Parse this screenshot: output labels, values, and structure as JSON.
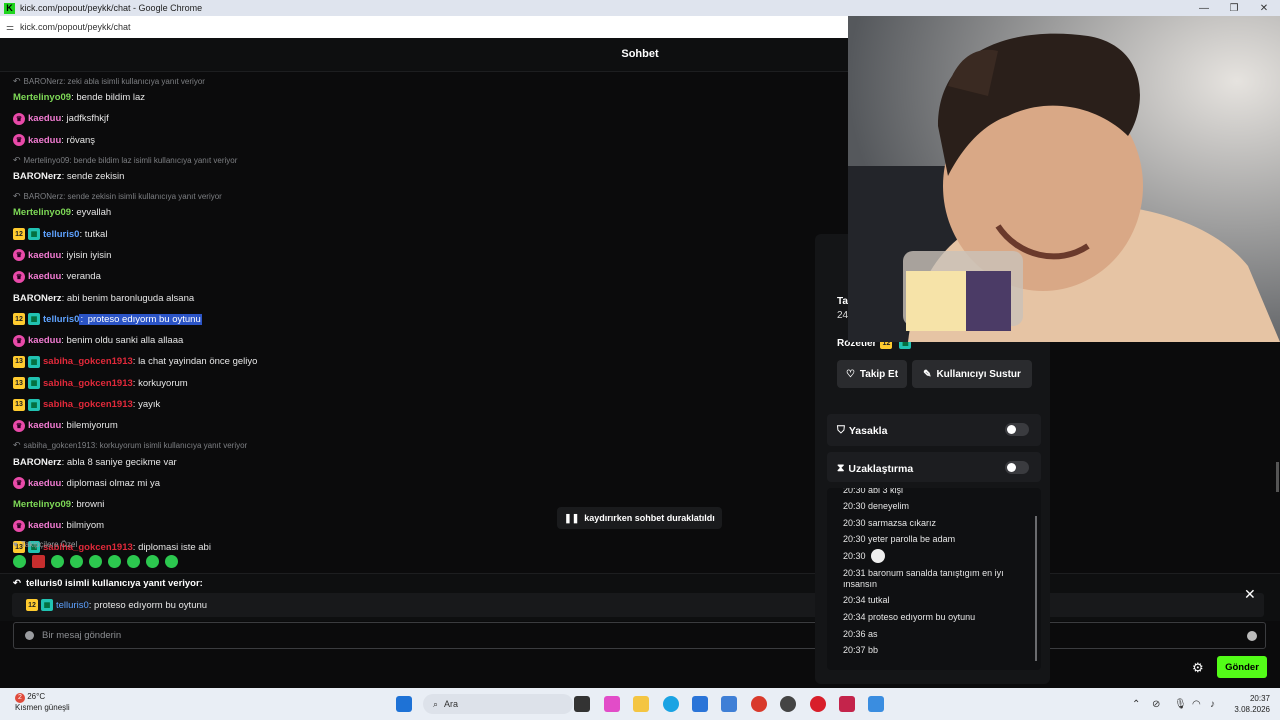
{
  "window": {
    "title": "kick.com/popout/peykk/chat - Google Chrome",
    "url": "kick.com/popout/peykk/chat",
    "app_icon": "K"
  },
  "chat": {
    "header": "Sohbet",
    "entries": [
      {
        "reply": "BARONerz: zeki abla isimli kullanıcıya yanıt veriyor",
        "user": "Mertelinyo09",
        "color": "g",
        "badges": [],
        "msg": "bende bildim laz"
      },
      {
        "user": "kaeduu",
        "color": "p",
        "badges": [
          "pink"
        ],
        "msg": "jadfksfhkjf"
      },
      {
        "user": "kaeduu",
        "color": "p",
        "badges": [
          "pink"
        ],
        "msg": "rövanş"
      },
      {
        "reply": "Mertelinyo09: bende bildim laz isimli kullanıcıya yanıt veriyor",
        "user": "BARONerz",
        "color": "w",
        "badges": [],
        "msg": "sende zekisin"
      },
      {
        "reply": "BARONerz: sende zekisin isimli kullanıcıya yanıt veriyor",
        "user": "Mertelinyo09",
        "color": "g",
        "badges": [],
        "msg": "eyvallah"
      },
      {
        "user": "telluris0",
        "color": "b",
        "badges": [
          "gold",
          "teal"
        ],
        "badge_text": "12",
        "msg": "tutkal"
      },
      {
        "user": "kaeduu",
        "color": "p",
        "badges": [
          "pink"
        ],
        "msg": "iyisin iyisin"
      },
      {
        "user": "kaeduu",
        "color": "p",
        "badges": [
          "pink"
        ],
        "msg": "veranda"
      },
      {
        "user": "BARONerz",
        "color": "w",
        "badges": [],
        "msg": "abi benim baronluguda alsana"
      },
      {
        "user": "telluris0",
        "color": "b",
        "badges": [
          "gold",
          "teal"
        ],
        "badge_text": "12",
        "msg": "proteso edıyorm bu oytunu",
        "highlight": true
      },
      {
        "user": "kaeduu",
        "color": "p",
        "badges": [
          "pink"
        ],
        "msg": "benim oldu sanki alla allaaa"
      },
      {
        "user": "sabiha_gokcen1913",
        "color": "r",
        "badges": [
          "gold",
          "teal"
        ],
        "badge_text": "13",
        "msg": "la chat yayindan önce geliyo"
      },
      {
        "user": "sabiha_gokcen1913",
        "color": "r",
        "badges": [
          "gold",
          "teal"
        ],
        "badge_text": "13",
        "msg": "korkuyorum"
      },
      {
        "user": "sabiha_gokcen1913",
        "color": "r",
        "badges": [
          "gold",
          "teal"
        ],
        "badge_text": "13",
        "msg": "yayık"
      },
      {
        "user": "kaeduu",
        "color": "p",
        "badges": [
          "pink"
        ],
        "msg": "bilemiyorum"
      },
      {
        "reply": "sabiha_gokcen1913: korkuyorum isimli kullanıcıya yanıt veriyor",
        "user": "BARONerz",
        "color": "w",
        "badges": [],
        "msg": "abla 8 saniye gecikme var"
      },
      {
        "user": "kaeduu",
        "color": "p",
        "badges": [
          "pink"
        ],
        "msg": "diplomasi olmaz mi ya"
      },
      {
        "user": "Mertelinyo09",
        "color": "g",
        "badges": [],
        "msg": "browni"
      },
      {
        "user": "kaeduu",
        "color": "p",
        "badges": [
          "pink"
        ],
        "msg": "bilmiyom"
      },
      {
        "user": "sabiha_gokcen1913",
        "color": "r",
        "badges": [
          "gold",
          "teal"
        ],
        "badge_text": "13",
        "msg": "diplomasi iste abi"
      }
    ],
    "paused_notice": "kaydırırken sohbet duraklatıldı",
    "follower_emotes_label": "Takipçilere Özel",
    "replying_to_header": "telluris0 isimli kullanıcıya yanıt veriyor:",
    "reply_quote": {
      "badge_text": "12",
      "user": "telluris0",
      "msg": "proteso edıyorm bu oytunu"
    },
    "input_placeholder": "Bir mesaj gönderin",
    "send_label": "Gönder"
  },
  "user_panel": {
    "fragment_name": "Ta",
    "fragment_sub": "24",
    "badges_label": "Rozetler",
    "badge_text": "12",
    "follow_label": "Takip Et",
    "mute_label": "Kullanıcıyı Sustur",
    "ban_label": "Yasakla",
    "timeout_label": "Uzaklaştırma",
    "history": [
      "20:30 abi 3 kişi",
      "20:30 deneyelim",
      "20:30 sarmazsa cıkarız",
      "20:30 yeter parolla be adam",
      "20:30",
      "20:31 baronum sanalda tanıştıgım en iyı ınsansın",
      "20:34 tutkal",
      "20:34 proteso edıyorm bu oytunu",
      "20:36 as",
      "20:37 bb"
    ]
  },
  "taskbar": {
    "weather_temp": "26°C",
    "weather_desc": "Kısmen güneşli",
    "weather_alert": "2",
    "search_label": "Ara",
    "time": "20:37",
    "date": "3.08.2026"
  }
}
